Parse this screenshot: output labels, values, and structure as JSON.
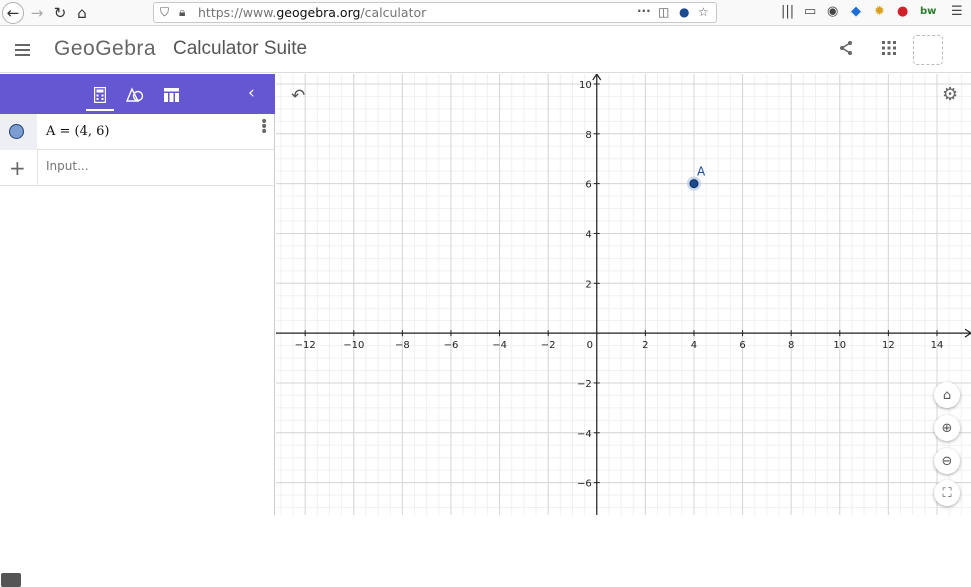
{
  "browser": {
    "url_prefix": "https://www.",
    "url_domain": "geogebra.org",
    "url_path": "/calculator"
  },
  "header": {
    "logo": "GeoGebra",
    "title": "Calculator Suite"
  },
  "algebra": {
    "items": [
      {
        "expression": "A = (4, 6)",
        "color": "#7b9dd2"
      }
    ],
    "input_placeholder": "Input..."
  },
  "graph": {
    "x_ticks": [
      "-12",
      "-10",
      "-8",
      "-6",
      "-4",
      "-2",
      "0",
      "2",
      "4",
      "6",
      "8",
      "10",
      "12",
      "14"
    ],
    "y_ticks": [
      "10",
      "8",
      "6",
      "4",
      "2",
      "-2",
      "-4",
      "-6"
    ],
    "points": [
      {
        "label": "A",
        "x": 4,
        "y": 6,
        "color": "#1a4a90"
      }
    ],
    "x_range": [
      -13.2,
      15.4
    ],
    "y_range": [
      -7.3,
      10.4
    ]
  },
  "colors": {
    "accent": "#6557d2",
    "point": "#1a4a90"
  }
}
